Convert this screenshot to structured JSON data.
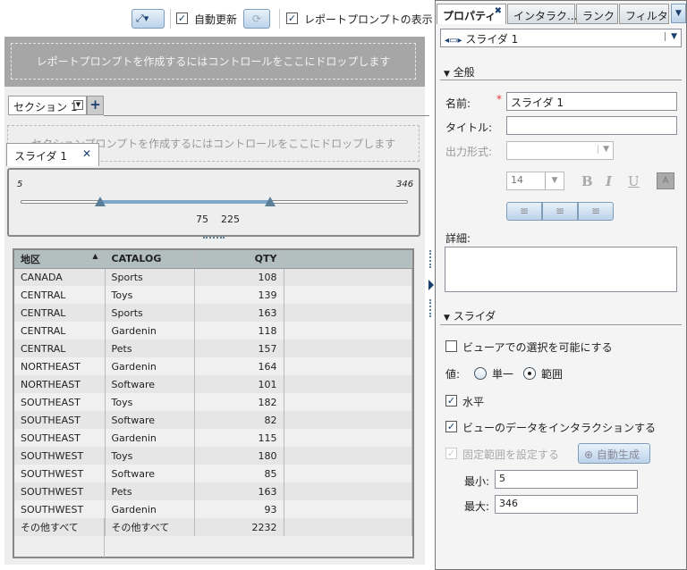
{
  "toolbar": {
    "auto_update": "自動更新",
    "show_report_prompt": "レポートプロンプトの表示"
  },
  "report_prompt_drop": "レポートプロンプトを作成するにはコントロールをここにドロップします",
  "section_tab": "セクション 1",
  "section_prompt_drop": "セクションプロンプトを作成するにはコントロールをここにドロップします",
  "slider": {
    "tab_label": "スライダ 1",
    "min": "5",
    "max": "346",
    "low": "75",
    "high": "225",
    "min_value": 5,
    "max_value": 346,
    "low_value": 75,
    "high_value": 225
  },
  "table": {
    "headers": [
      "地区",
      "CATALOG",
      "QTY"
    ],
    "rows": [
      [
        "CANADA",
        "Sports",
        "108"
      ],
      [
        "CENTRAL",
        "Toys",
        "139"
      ],
      [
        "CENTRAL",
        "Sports",
        "163"
      ],
      [
        "CENTRAL",
        "Gardenin",
        "118"
      ],
      [
        "CENTRAL",
        "Pets",
        "157"
      ],
      [
        "NORTHEAST",
        "Gardenin",
        "164"
      ],
      [
        "NORTHEAST",
        "Software",
        "101"
      ],
      [
        "SOUTHEAST",
        "Toys",
        "182"
      ],
      [
        "SOUTHEAST",
        "Software",
        "82"
      ],
      [
        "SOUTHEAST",
        "Gardenin",
        "115"
      ],
      [
        "SOUTHWEST",
        "Toys",
        "180"
      ],
      [
        "SOUTHWEST",
        "Software",
        "85"
      ],
      [
        "SOUTHWEST",
        "Pets",
        "163"
      ],
      [
        "SOUTHWEST",
        "Gardenin",
        "93"
      ],
      [
        "その他すべて",
        "その他すべて",
        "2232"
      ]
    ]
  },
  "panel": {
    "tabs": [
      "プロパティ",
      "インタラク...",
      "ランク",
      "フィルタ"
    ],
    "object_select": "スライダ 1",
    "general_header": "全般",
    "name_label": "名前:",
    "name_value": "スライダ 1",
    "title_label": "タイトル:",
    "title_value": "",
    "format_label": "出力形式:",
    "font_size": "14",
    "bold": "B",
    "italic": "I",
    "underline": "U",
    "detail_label": "詳細:",
    "slider_header": "スライダ",
    "viewer_select": "ビューアでの選択を可能にする",
    "value_label": "値:",
    "single": "単一",
    "range": "範囲",
    "horizontal": "水平",
    "interact": "ビューのデータをインタラクションする",
    "fixed_range": "固定範囲を設定する",
    "auto_generate": "自動生成",
    "min_label": "最小:",
    "min_value": "5",
    "max_label": "最大:",
    "max_value": "346"
  }
}
